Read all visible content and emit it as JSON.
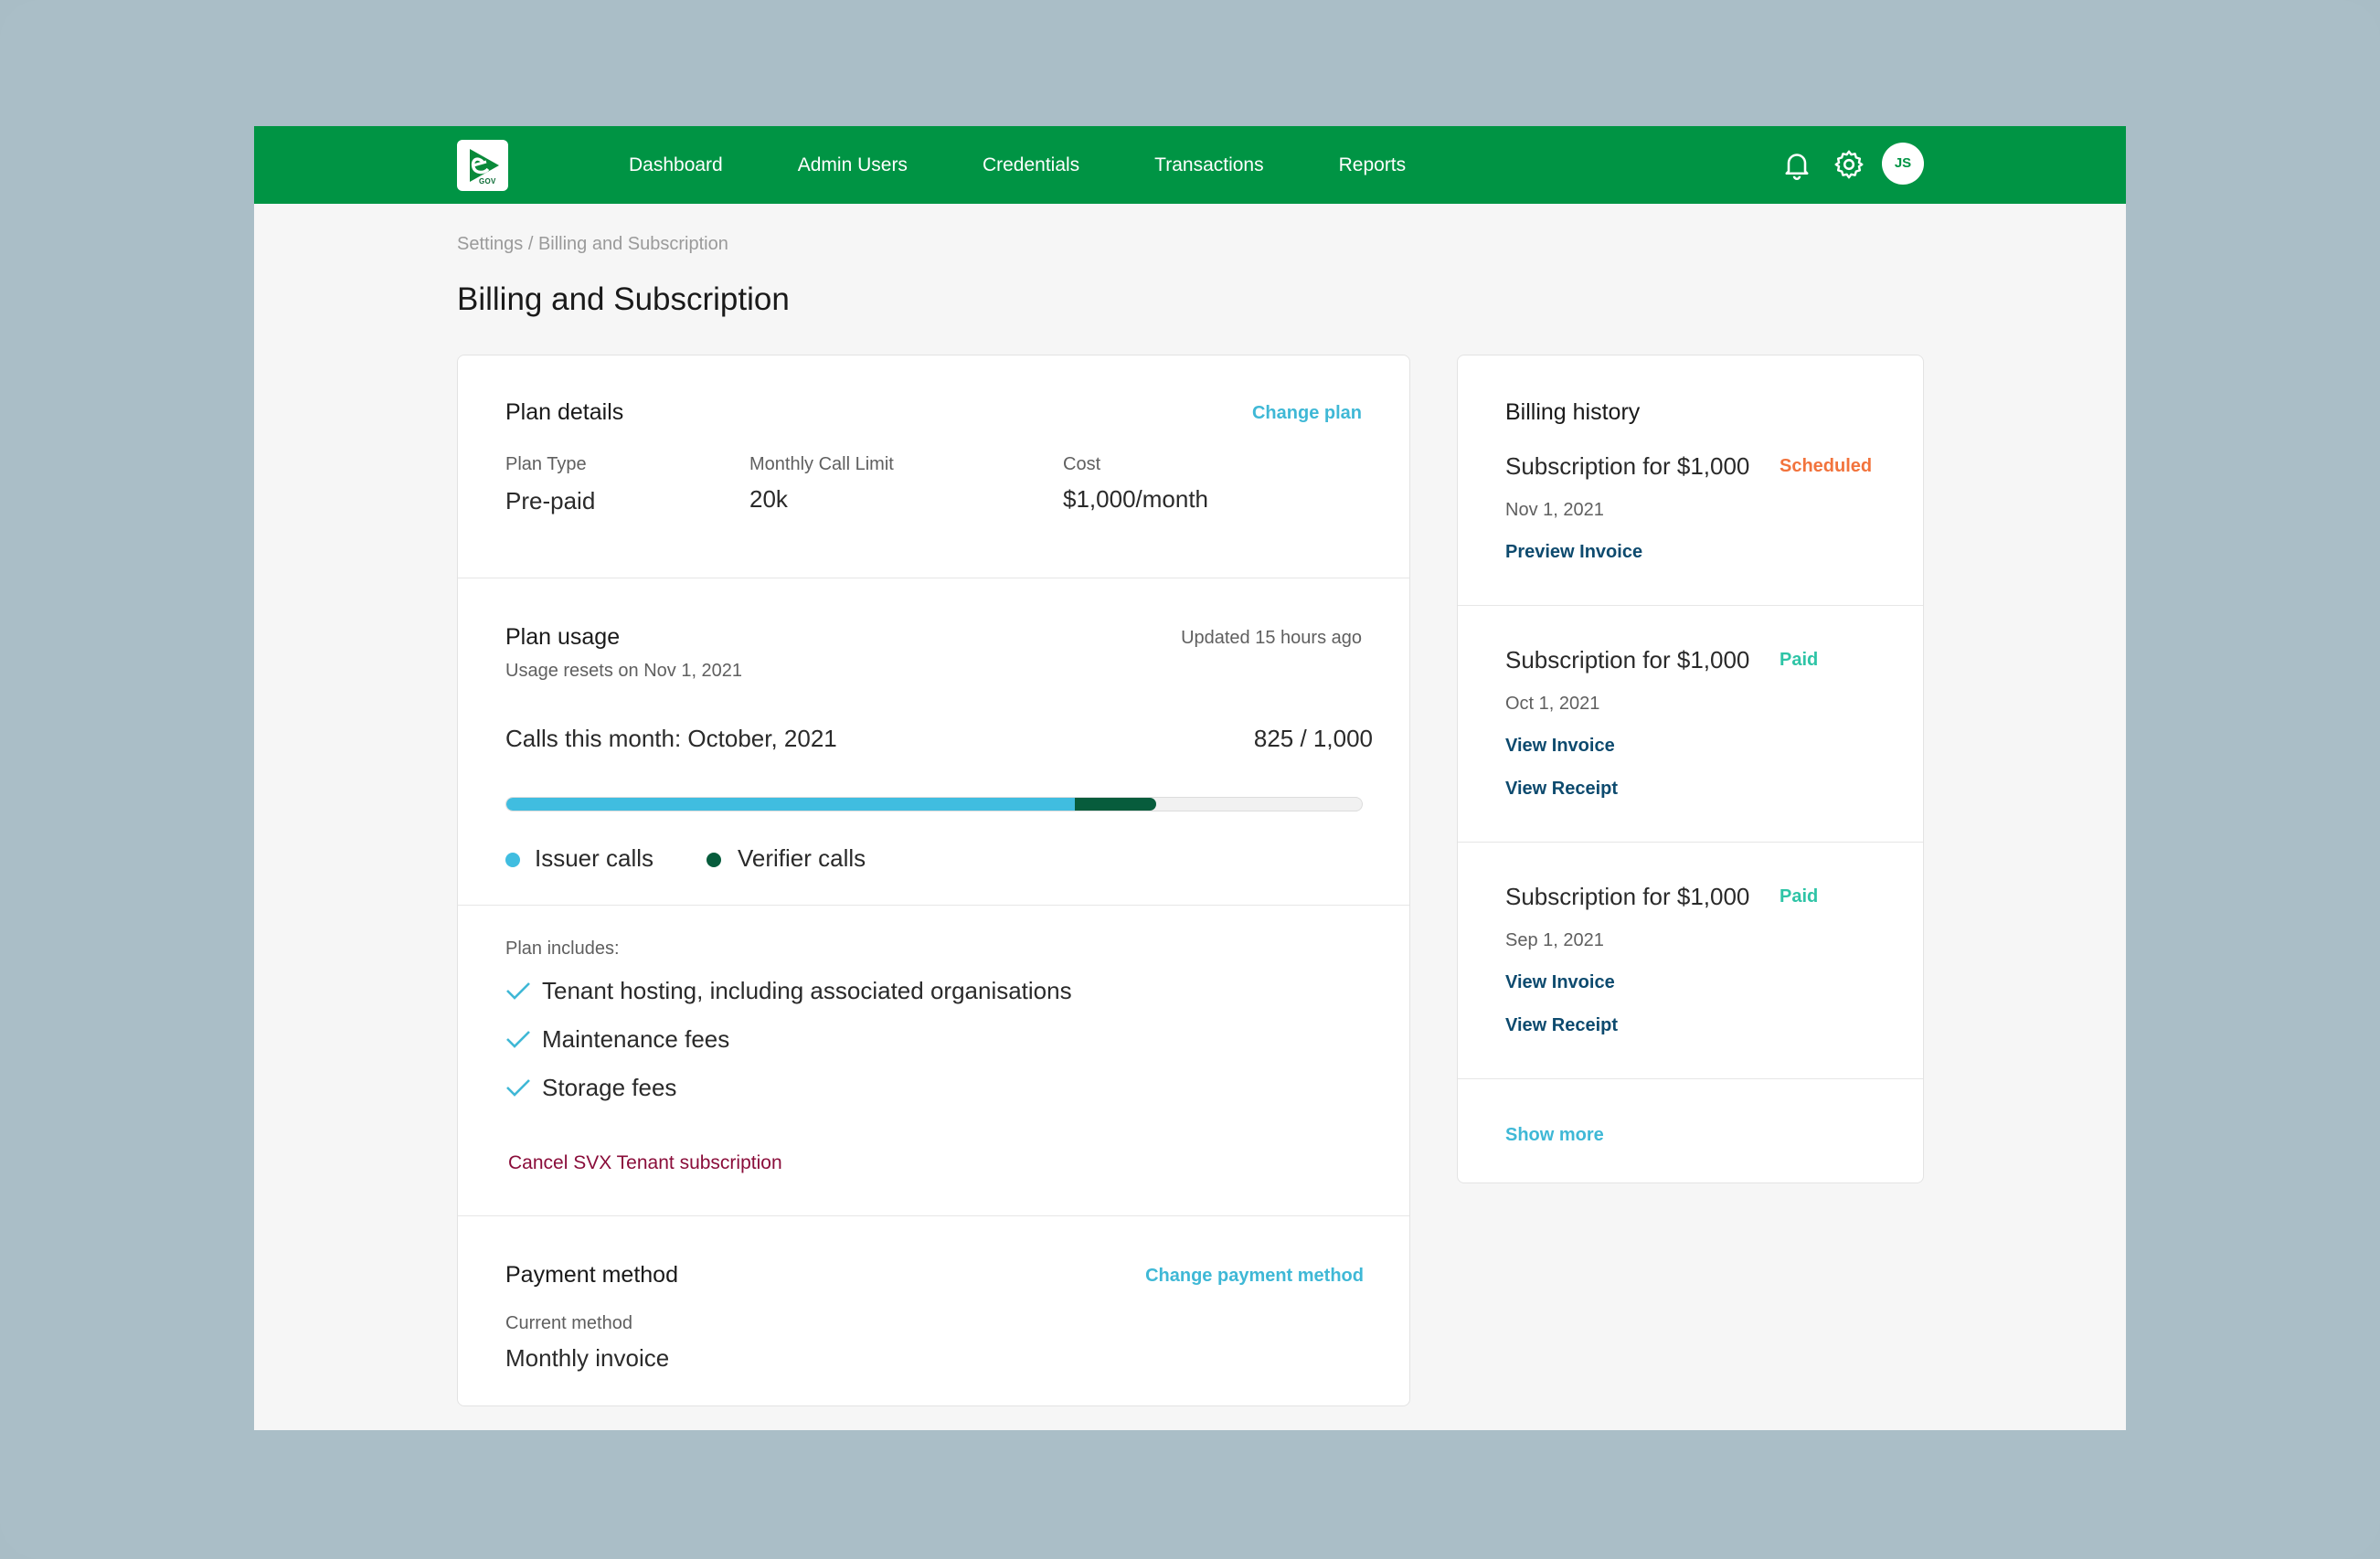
{
  "nav": {
    "logo_text": "GOV",
    "items": [
      {
        "label": "Dashboard"
      },
      {
        "label": "Admin Users"
      },
      {
        "label": "Credentials"
      },
      {
        "label": "Transactions"
      },
      {
        "label": "Reports"
      }
    ],
    "icons": [
      "bell-icon",
      "gear-icon"
    ],
    "avatar_initials": "JS"
  },
  "breadcrumb": {
    "parent": "Settings",
    "separator": " / ",
    "current": "Billing and Subscription"
  },
  "page_title": "Billing and Subscription",
  "plan_details": {
    "title": "Plan details",
    "change_label": "Change plan",
    "fields": [
      {
        "label": "Plan Type",
        "value": "Pre-paid"
      },
      {
        "label": "Monthly Call Limit",
        "value": "20k"
      },
      {
        "label": "Cost",
        "value": "$1,000/month"
      }
    ]
  },
  "plan_usage": {
    "title": "Plan usage",
    "updated": "Updated 15 hours ago",
    "resets": "Usage resets on Nov 1, 2021",
    "calls_label": "Calls this month: October, 2021",
    "calls_count": "825 / 1,000",
    "issuer_fraction": 0.665,
    "verifier_fraction": 0.095,
    "legend": [
      {
        "label": "Issuer calls",
        "color": "#40bde0"
      },
      {
        "label": "Verifier calls",
        "color": "#075c3c"
      }
    ]
  },
  "plan_includes": {
    "title": "Plan includes:",
    "items": [
      "Tenant hosting, including associated organisations",
      "Maintenance fees",
      "Storage fees"
    ],
    "cancel_label": "Cancel SVX Tenant subscription"
  },
  "payment": {
    "title": "Payment method",
    "change_label": "Change payment method",
    "current_label": "Current method",
    "current_value": "Monthly invoice"
  },
  "billing_history": {
    "title": "Billing history",
    "entries": [
      {
        "subject": "Subscription for $1,000",
        "status": "Scheduled",
        "status_color": "#f2733c",
        "date": "Nov 1, 2021",
        "links": [
          "Preview Invoice"
        ]
      },
      {
        "subject": "Subscription for $1,000",
        "status": "Paid",
        "status_color": "#2ec4a6",
        "date": "Oct 1, 2021",
        "links": [
          "View Invoice",
          "View Receipt"
        ]
      },
      {
        "subject": "Subscription for $1,000",
        "status": "Paid",
        "status_color": "#2ec4a6",
        "date": "Sep 1, 2021",
        "links": [
          "View Invoice",
          "View Receipt"
        ]
      }
    ],
    "show_more": "Show more"
  },
  "colors": {
    "brand_green": "#009444",
    "teal_link": "#3fb8d6",
    "navy_link": "#0d4a6e",
    "cancel_red": "#8a0d3a"
  }
}
